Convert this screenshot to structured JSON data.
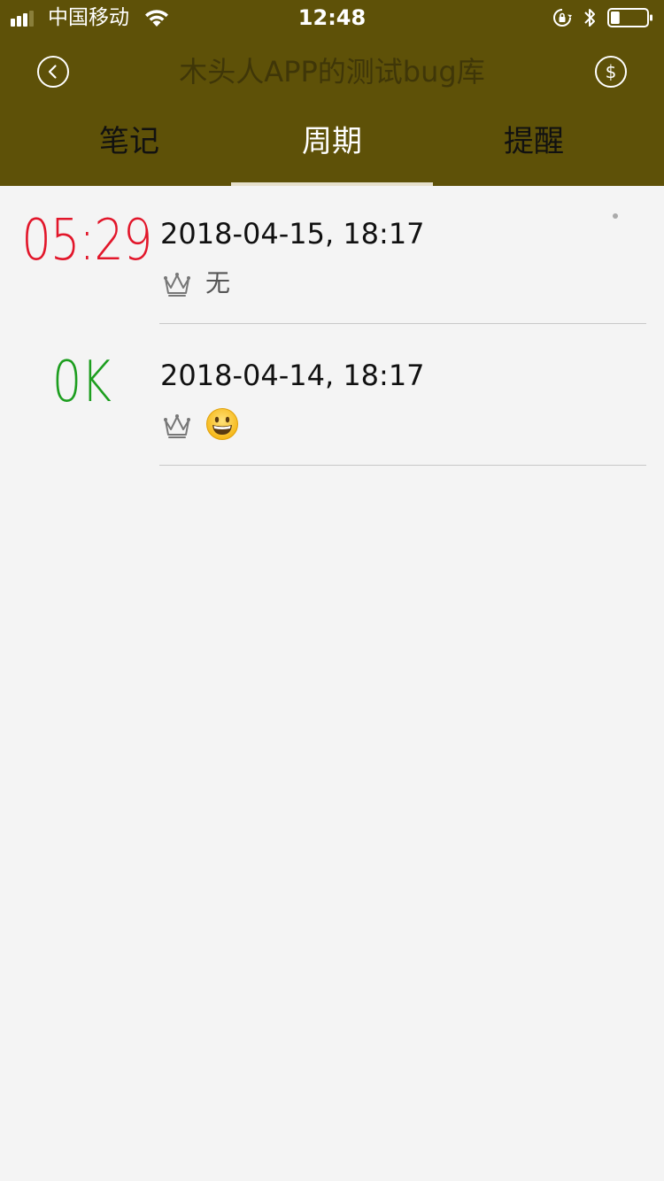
{
  "status_bar": {
    "carrier": "中国移动",
    "time": "12:48",
    "battery_level": 0.25
  },
  "nav": {
    "title": "木头人APP的测试bug库",
    "right_icon_text": "$"
  },
  "tabs": [
    {
      "label": "笔记",
      "active": false
    },
    {
      "label": "周期",
      "active": true
    },
    {
      "label": "提醒",
      "active": false
    }
  ],
  "colors": {
    "header_bg": "#5e5108",
    "status_overdue": "#e2162a",
    "status_ok": "#1d9e1f",
    "divider": "#c8c8c8"
  },
  "rows": [
    {
      "status": "05:29",
      "status_color": "#e2162a",
      "date": "2018-04-15, 18:17",
      "icon": "crown-icon",
      "note": "无"
    },
    {
      "status": "0K",
      "status_color": "#1d9e1f",
      "date": "2018-04-14, 18:17",
      "icon": "crown-icon",
      "note_icon": "grinning-face-emoji"
    }
  ]
}
